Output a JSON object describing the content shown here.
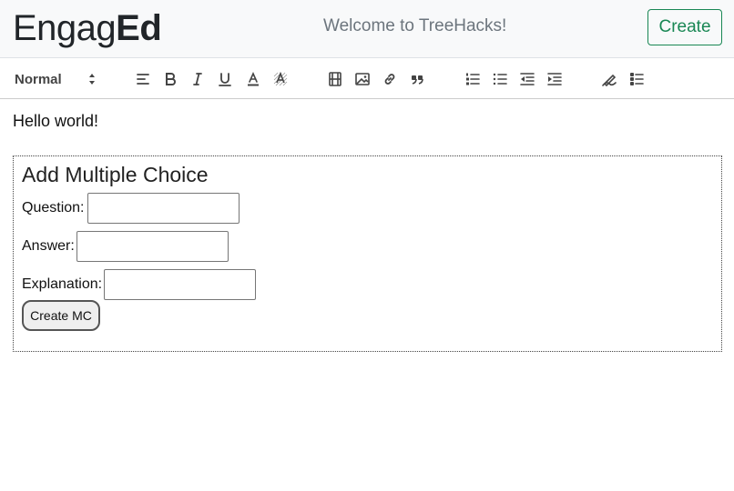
{
  "header": {
    "brand_regular": "Engag",
    "brand_bold": "Ed",
    "welcome": "Welcome to TreeHacks!",
    "create_label": "Create"
  },
  "toolbar": {
    "format_value": "Normal",
    "icons": [
      "align-icon",
      "bold-icon",
      "italic-icon",
      "underline-icon",
      "text-color-icon",
      "background-color-icon",
      "video-icon",
      "image-icon",
      "link-icon",
      "blockquote-icon",
      "ordered-list-icon",
      "bullet-list-icon",
      "outdent-icon",
      "indent-icon",
      "draw-icon",
      "checklist-icon"
    ]
  },
  "editor": {
    "text": "Hello world!"
  },
  "mc_form": {
    "title": "Add Multiple Choice",
    "question_label": "Question:",
    "answer_label": "Answer:",
    "explanation_label": "Explanation:",
    "question_value": "",
    "answer_value": "",
    "explanation_value": "",
    "submit_label": "Create MC"
  },
  "colors": {
    "accent_green": "#198754",
    "header_bg": "#f8f9fa",
    "muted_text": "#6c757d"
  }
}
